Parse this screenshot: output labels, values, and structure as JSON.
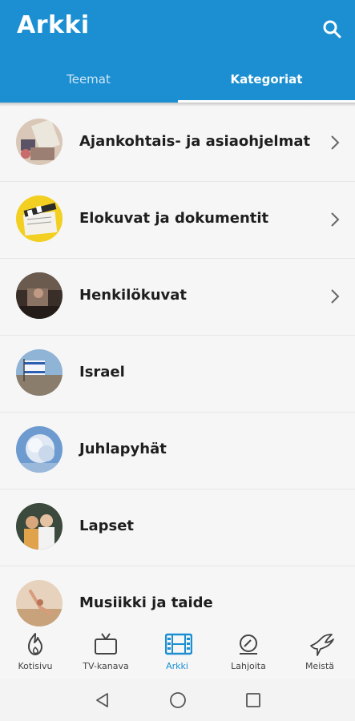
{
  "app": {
    "title": "Arkki"
  },
  "tabs": [
    {
      "label": "Teemat",
      "selected": false
    },
    {
      "label": "Kategoriat",
      "selected": true
    }
  ],
  "categories": [
    {
      "label": "Ajankohtais- ja asiaohjelmat",
      "has_chevron": true
    },
    {
      "label": "Elokuvat ja dokumentit",
      "has_chevron": true
    },
    {
      "label": "Henkilökuvat",
      "has_chevron": true
    },
    {
      "label": "Israel",
      "has_chevron": false
    },
    {
      "label": "Juhlapyhät",
      "has_chevron": false
    },
    {
      "label": "Lapset",
      "has_chevron": false
    },
    {
      "label": "Musiikki ja taide",
      "has_chevron": false
    }
  ],
  "bottom_nav": [
    {
      "label": "Kotisivu",
      "icon": "flame-icon",
      "active": false
    },
    {
      "label": "TV-kanava",
      "icon": "tv-icon",
      "active": false
    },
    {
      "label": "Arkki",
      "icon": "film-icon",
      "active": true
    },
    {
      "label": "Lahjoita",
      "icon": "donate-icon",
      "active": false
    },
    {
      "label": "Meistä",
      "icon": "dove-icon",
      "active": false
    }
  ],
  "colors": {
    "primary": "#1b8fd1",
    "background": "#f6f6f6"
  }
}
